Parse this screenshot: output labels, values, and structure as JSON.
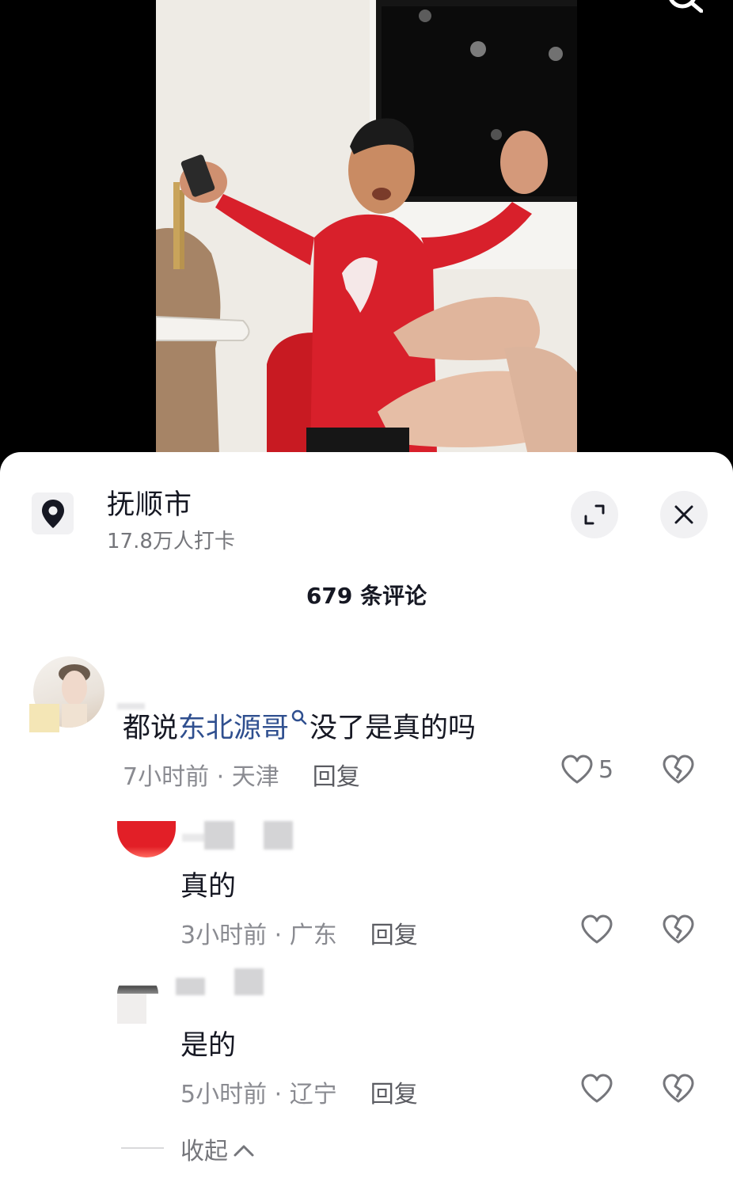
{
  "location": {
    "name": "抚顺市",
    "checkins": "17.8万人打卡",
    "pin_icon": "location-pin-icon",
    "expand_icon": "expand-icon",
    "close_icon": "close-icon"
  },
  "comments_header": {
    "count_label": "679 条评论"
  },
  "comments": [
    {
      "text_before": "都说",
      "link_text": "东北源哥",
      "text_after": "没了是真的吗",
      "time": "7小时前",
      "region": "天津",
      "reply_label": "回复",
      "likes": "5",
      "replies": [
        {
          "text": "真的",
          "time": "3小时前",
          "region": "广东",
          "reply_label": "回复"
        },
        {
          "text": "是的",
          "time": "5小时前",
          "region": "辽宁",
          "reply_label": "回复"
        }
      ]
    }
  ],
  "collapse_label": "收起",
  "colors": {
    "accent_link": "#2f4f8f",
    "sheet_bg": "#ffffff",
    "shirt_red": "#d8202b"
  }
}
